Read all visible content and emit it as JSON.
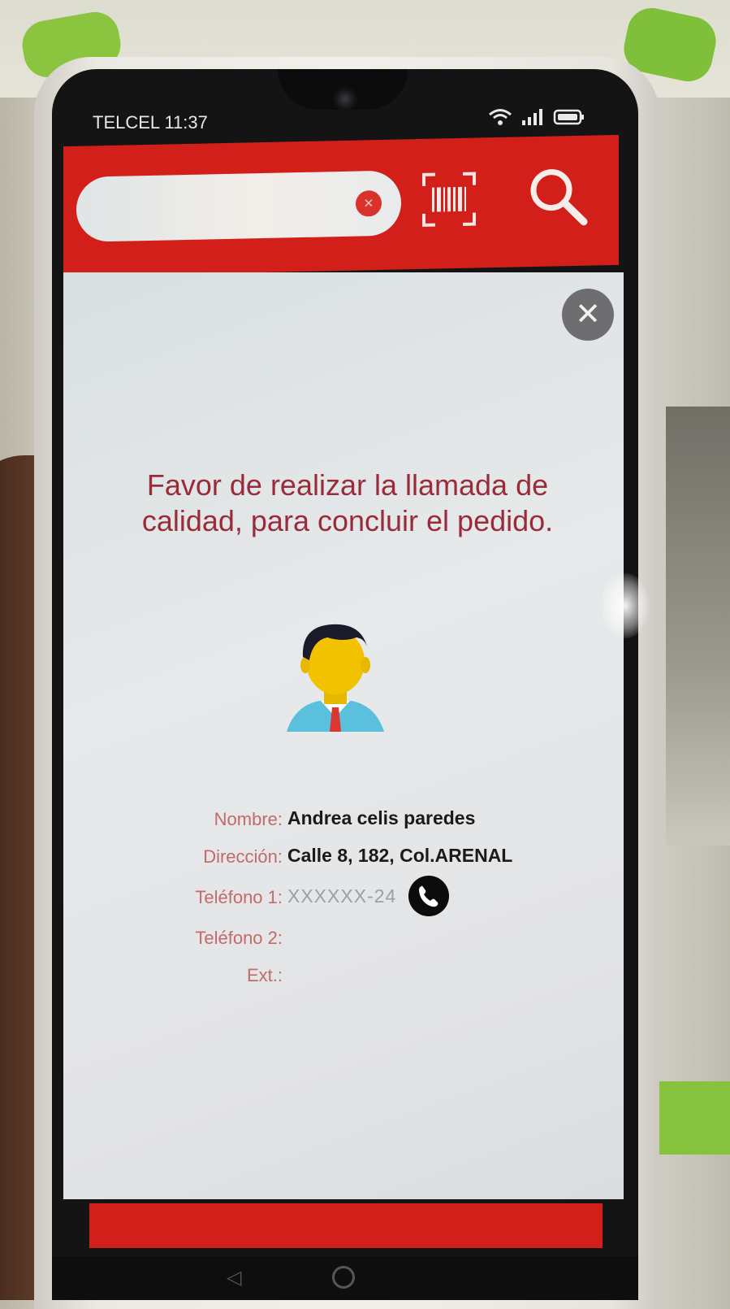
{
  "status_bar": {
    "carrier": "TELCEL",
    "time": "11:37"
  },
  "header": {
    "search_placeholder": "",
    "clear_icon": "close-circle-icon",
    "barcode_icon": "barcode-scan-icon",
    "search_icon": "search-icon",
    "accent_color": "#d21f1a"
  },
  "dialog": {
    "close_icon": "close-icon",
    "message": "Favor de realizar la llamada de calidad, para concluir el pedido.",
    "avatar_icon": "person-avatar-icon",
    "fields": [
      {
        "label": "Nombre:",
        "value": "Andrea celis paredes"
      },
      {
        "label": "Dirección:",
        "value": "Calle 8, 182, Col.ARENAL"
      },
      {
        "label": "Teléfono 1:",
        "value": "XXXXXX-24"
      },
      {
        "label": "Teléfono 2:",
        "value": ""
      },
      {
        "label": "Ext.:",
        "value": ""
      }
    ],
    "call_icon": "phone-call-icon"
  }
}
